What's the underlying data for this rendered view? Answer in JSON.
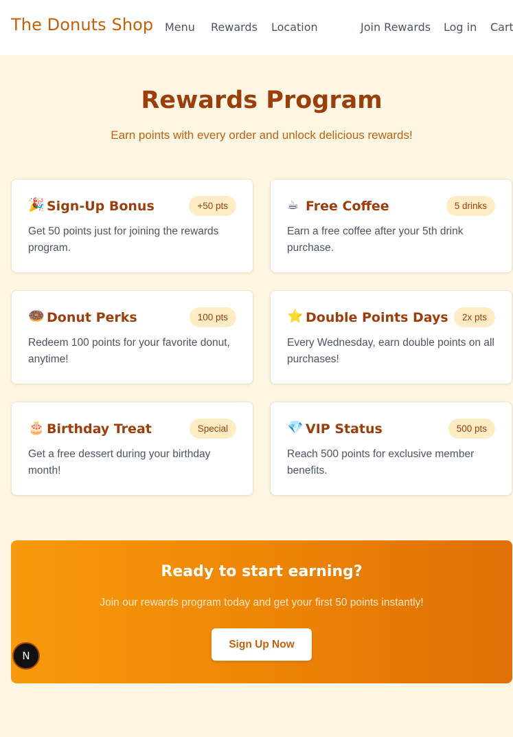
{
  "header": {
    "brand": "The Donuts Shop",
    "nav": [
      "Menu",
      "Rewards",
      "Location"
    ],
    "join_rewards": "Join Rewards",
    "log_in": "Log in",
    "cart": "Cart"
  },
  "hero": {
    "title": "Rewards Program",
    "subtitle": "Earn points with every order and unlock delicious rewards!"
  },
  "rewards": [
    {
      "emoji": "🎉",
      "icon": "party-popper-icon",
      "title": "Sign-Up Bonus",
      "badge": "+50 pts",
      "description": "Get 50 points just for joining the rewards program."
    },
    {
      "emoji": "☕",
      "icon": "coffee-icon",
      "title": "Free Coffee",
      "badge": "5 drinks",
      "description": "Earn a free coffee after your 5th drink purchase."
    },
    {
      "emoji": "🍩",
      "icon": "donut-icon",
      "title": "Donut Perks",
      "badge": "100 pts",
      "description": "Redeem 100 points for your favorite donut, anytime!"
    },
    {
      "emoji": "⭐",
      "icon": "star-icon",
      "title": "Double Points Days",
      "badge": "2x pts",
      "description": "Every Wednesday, earn double points on all purchases!"
    },
    {
      "emoji": "🎂",
      "icon": "birthday-cake-icon",
      "title": "Birthday Treat",
      "badge": "Special",
      "description": "Get a free dessert during your birthday month!"
    },
    {
      "emoji": "💎",
      "icon": "gem-icon",
      "title": "VIP Status",
      "badge": "500 pts",
      "description": "Reach 500 points for exclusive member benefits."
    }
  ],
  "cta": {
    "title": "Ready to start earning?",
    "text": "Join our rewards program today and get your first 50 points instantly!",
    "button": "Sign Up Now"
  },
  "dev_badge": "N",
  "colors": {
    "brand": "#c2610c",
    "heading": "#9a3f0c",
    "page_bg": "#fdf6e3",
    "badge_bg": "#fdecc4",
    "cta_gradient_start": "#f89a0d",
    "cta_gradient_end": "#df6f06"
  }
}
